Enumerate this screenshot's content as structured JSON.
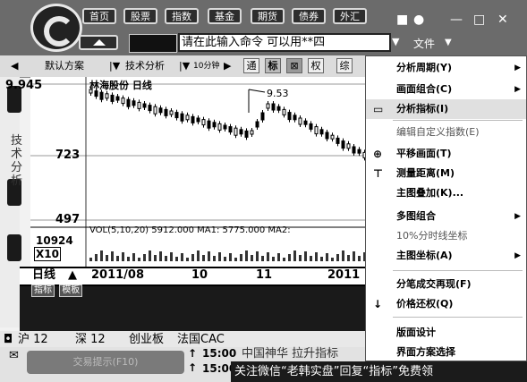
{
  "nav": {
    "buttons": [
      "首页",
      "股票",
      "指数",
      "基金",
      "期货",
      "债券",
      "外汇"
    ]
  },
  "command_input": {
    "value": "请在此输入命令   可以用**四"
  },
  "file_menu": "文件",
  "toolbar": {
    "scheme": "默认方案",
    "tech_analysis": "技术分析",
    "period": "10分钟",
    "btn_tong": "通",
    "btn_biao": "标",
    "btn_quan": "权",
    "btn_zong": "综"
  },
  "chart": {
    "title": "林海股份 日线",
    "price_top": "9.945",
    "price_mid": "723",
    "price_low": "497",
    "peak_label": "9.53",
    "vol_info": "VOL(5,10,20) 5912.000  MA1: 5775.000  MA2:",
    "vol_top": "10924",
    "vol_unit": "X10",
    "period_tab": "日线",
    "dates": [
      "2011/08",
      "10",
      "11",
      "2011"
    ],
    "sub_tabs": [
      "指标",
      "模板"
    ],
    "side_tab": "技术分析"
  },
  "context_menu": {
    "items": [
      {
        "label": "分析周期(Y)",
        "icon": "",
        "arrow": true
      },
      {
        "label": "画面组合(C)",
        "icon": "",
        "arrow": true
      },
      {
        "label": "分析指标(I)",
        "icon": "indicator-icon",
        "arrow": false,
        "highlight": true
      },
      {
        "label": "编辑自定义指数(E)",
        "icon": "",
        "arrow": false,
        "dim": true
      },
      {
        "label": "平移画面(T)",
        "icon": "move-icon",
        "arrow": false
      },
      {
        "label": "测量距离(M)",
        "icon": "measure-icon",
        "arrow": false
      },
      {
        "label": "主图叠加(K)...",
        "icon": "",
        "arrow": false
      },
      {
        "label": "多图组合",
        "icon": "",
        "arrow": true
      },
      {
        "label": "10%分时线坐标",
        "icon": "",
        "arrow": false,
        "dim": true
      },
      {
        "label": "主图坐标(A)",
        "icon": "",
        "arrow": true
      },
      {
        "label": "分笔成交再现(F)",
        "icon": "",
        "arrow": false
      },
      {
        "label": "价格还权(Q)",
        "icon": "restore-icon",
        "arrow": false
      },
      {
        "label": "版面设计",
        "icon": "",
        "arrow": false
      },
      {
        "label": "界面方案选择",
        "icon": "",
        "arrow": false
      }
    ]
  },
  "market_bar": {
    "items": [
      "沪 12",
      "深 12",
      "创业板",
      "法国CAC"
    ]
  },
  "news": {
    "button": "交易提示(F10)",
    "times": [
      "15:00",
      "15:00"
    ],
    "headline": "中国神华 拉升指标"
  },
  "watermark": "关注微信“老韩实盘”回复“指标”免费领",
  "colors": {
    "topbar": "#6b6b6b",
    "menu_highlight": "#e0e0e0",
    "dark_panel": "#1a1a1a"
  }
}
